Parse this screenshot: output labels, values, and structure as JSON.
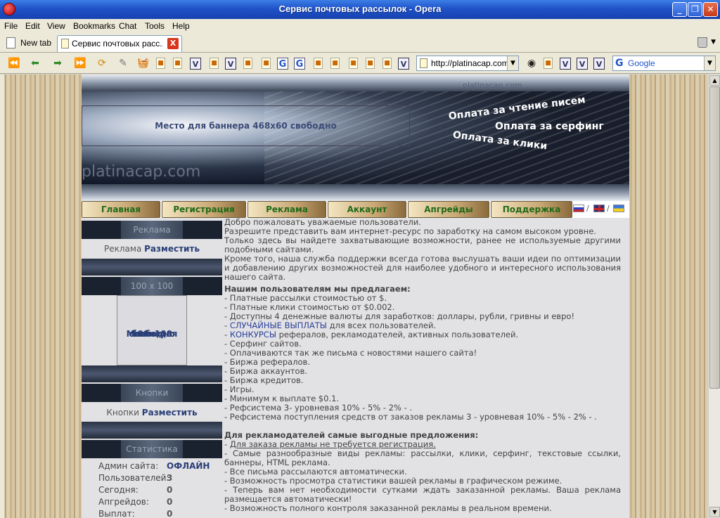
{
  "window": {
    "title": "Сервис почтовых рассылок - Opera",
    "buttons": [
      "_",
      "❐",
      "✕"
    ]
  },
  "menu": [
    "File",
    "Edit",
    "View",
    "Bookmarks",
    "Chat",
    "Tools",
    "Help"
  ],
  "tabs": {
    "new_tab": "New tab",
    "active": "Сервис почтовых расс...",
    "close": "X"
  },
  "address": {
    "url": "http://platinacap.com/"
  },
  "search": {
    "engine": "Google"
  },
  "header": {
    "domain": "platinacap.com",
    "banner": "Место для баннера 468x60 свободно",
    "pay1": "Оплата за чтение писем",
    "pay2": "Оплата за серфинг",
    "pay3": "Оплата за клики",
    "brand": "platinacap.com"
  },
  "nav": [
    "Главная",
    "Регистрация",
    "Реклама",
    "Аккаунт",
    "Апгрейды",
    "Поддержка"
  ],
  "flags": {
    "sep": "/"
  },
  "sidebar": {
    "ads_title": "Реклама",
    "ads_text": "Реклама",
    "place": "Разместить",
    "size_title": "100 x 100",
    "banner": [
      "Место для",
      "баннера",
      "100x100",
      "свободно"
    ],
    "buttons_title": "Кнопки",
    "buttons_text": "Кнопки",
    "stats_title": "Статистика",
    "stats": [
      {
        "label": "Админ сайта:",
        "value": "ОФЛАЙН"
      },
      {
        "label": "Пользователей:",
        "value": "3"
      },
      {
        "label": "Сегодня:",
        "value": "0"
      },
      {
        "label": "Апгрейдов:",
        "value": "0"
      },
      {
        "label": "Выплат:",
        "value": "0"
      }
    ]
  },
  "content": {
    "p1": "Добро пожаловать уважаемые пользователи.",
    "p2": "Разрешите представить вам интернет-ресурс по заработку на самом высоком уровне.",
    "p3": "Только здесь вы найдете захватывающие возможности, ранее не используемые другими подобными сайтами.",
    "p4": "Кроме того, наша служба поддержки всегда готова выслушать ваши идеи по оптимизации и добавлению других возможностей для наиболее удобного и интересного использования нашего сайта.",
    "users_title": "Нашим пользователям мы предлагаем:",
    "u1": "- Платные рассылки стоимостью от $.",
    "u2": "- Платные клики стоимостью от $0.002.",
    "u3": "- Доступны 4 денежные валюты для заработков: доллары, рубли, гривны и евро!",
    "u4_link": "СЛУЧАЙНЫЕ ВЫПЛАТЫ",
    "u4_rest": " для всех пользователей.",
    "u5_link": "КОНКУРСЫ",
    "u5_rest": " рефералов, рекламодателей, активных пользователей.",
    "u6": "- Серфинг сайтов.",
    "u7": "- Оплачиваются так же письма с новостями нашего сайта!",
    "u8": "- Биржа рефералов.",
    "u9": "- Биржа аккаунтов.",
    "u10": "- Биржа кредитов.",
    "u11": "- Игры.",
    "u12": "- Минимум к выплате $0.1.",
    "u13": "- Рефсистема 3- уровневая 10% - 5% - 2% - .",
    "u14": "- Рефсистема поступления средств от заказов рекламы 3 - уровневая 10% - 5% - 2% - .",
    "adv_title": "Для рекламодателей самые выгодные предложения:",
    "a1": "Для заказа рекламы не требуется регистрация.",
    "a2": "- Самые разнообразные виды рекламы: рассылки, клики, серфинг, текстовые ссылки, баннеры, HTML реклама.",
    "a3": "- Все письма рассылаются автоматически.",
    "a4": "- Возможность просмотра статистики вашей рекламы в графическом режиме.",
    "a5": "- Теперь вам нет необходимости сутками ждать заказанной рекламы. Ваша реклама размещается автоматически!",
    "a6": "- Возможность полного контроля заказанной рекламы в реальном времени."
  }
}
